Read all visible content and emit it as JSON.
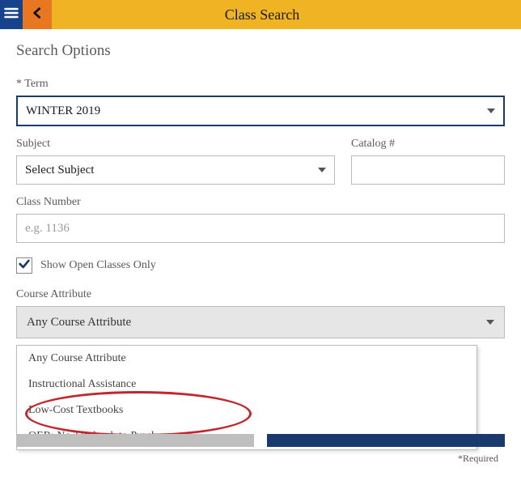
{
  "header": {
    "title": "Class Search"
  },
  "optionsHeading": "Search Options",
  "labels": {
    "term": "* Term",
    "subject": "Subject",
    "catalog": "Catalog #",
    "classNumber": "Class Number",
    "showOpen": "Show Open Classes Only",
    "courseAttribute": "Course Attribute"
  },
  "term": {
    "selected": "WINTER 2019"
  },
  "subject": {
    "selected": "Select Subject"
  },
  "catalog": {
    "value": ""
  },
  "classNumber": {
    "placeholder": "e.g. 1136",
    "value": ""
  },
  "showOpenClassesOnly": true,
  "courseAttribute": {
    "selected": "Any Course Attribute",
    "options": [
      "Any Course Attribute",
      "Instructional Assistance",
      "Low-Cost Textbooks",
      "OER: No Textbook to Purchase"
    ]
  },
  "requiredNote": "*Required"
}
